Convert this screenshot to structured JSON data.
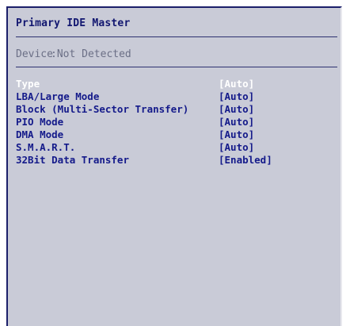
{
  "title": "Primary IDE Master",
  "device": {
    "label": "Device",
    "value": ":Not Detected"
  },
  "options": [
    {
      "label": "Type",
      "value": "[Auto]",
      "selected": true
    },
    {
      "label": "LBA/Large Mode",
      "value": "[Auto]"
    },
    {
      "label": "Block (Multi-Sector Transfer)",
      "value": "[Auto]"
    },
    {
      "label": "PIO Mode",
      "value": "[Auto]"
    },
    {
      "label": "DMA Mode",
      "value": "[Auto]"
    },
    {
      "label": "S.M.A.R.T.",
      "value": "[Auto]"
    },
    {
      "label": "32Bit Data Transfer",
      "value": "[Enabled]"
    }
  ],
  "colors": {
    "panel_background": "#c9cbd7",
    "text_blue": "#141a8a",
    "selected_text": "#ffffff",
    "dim_text": "#6b6f86"
  }
}
